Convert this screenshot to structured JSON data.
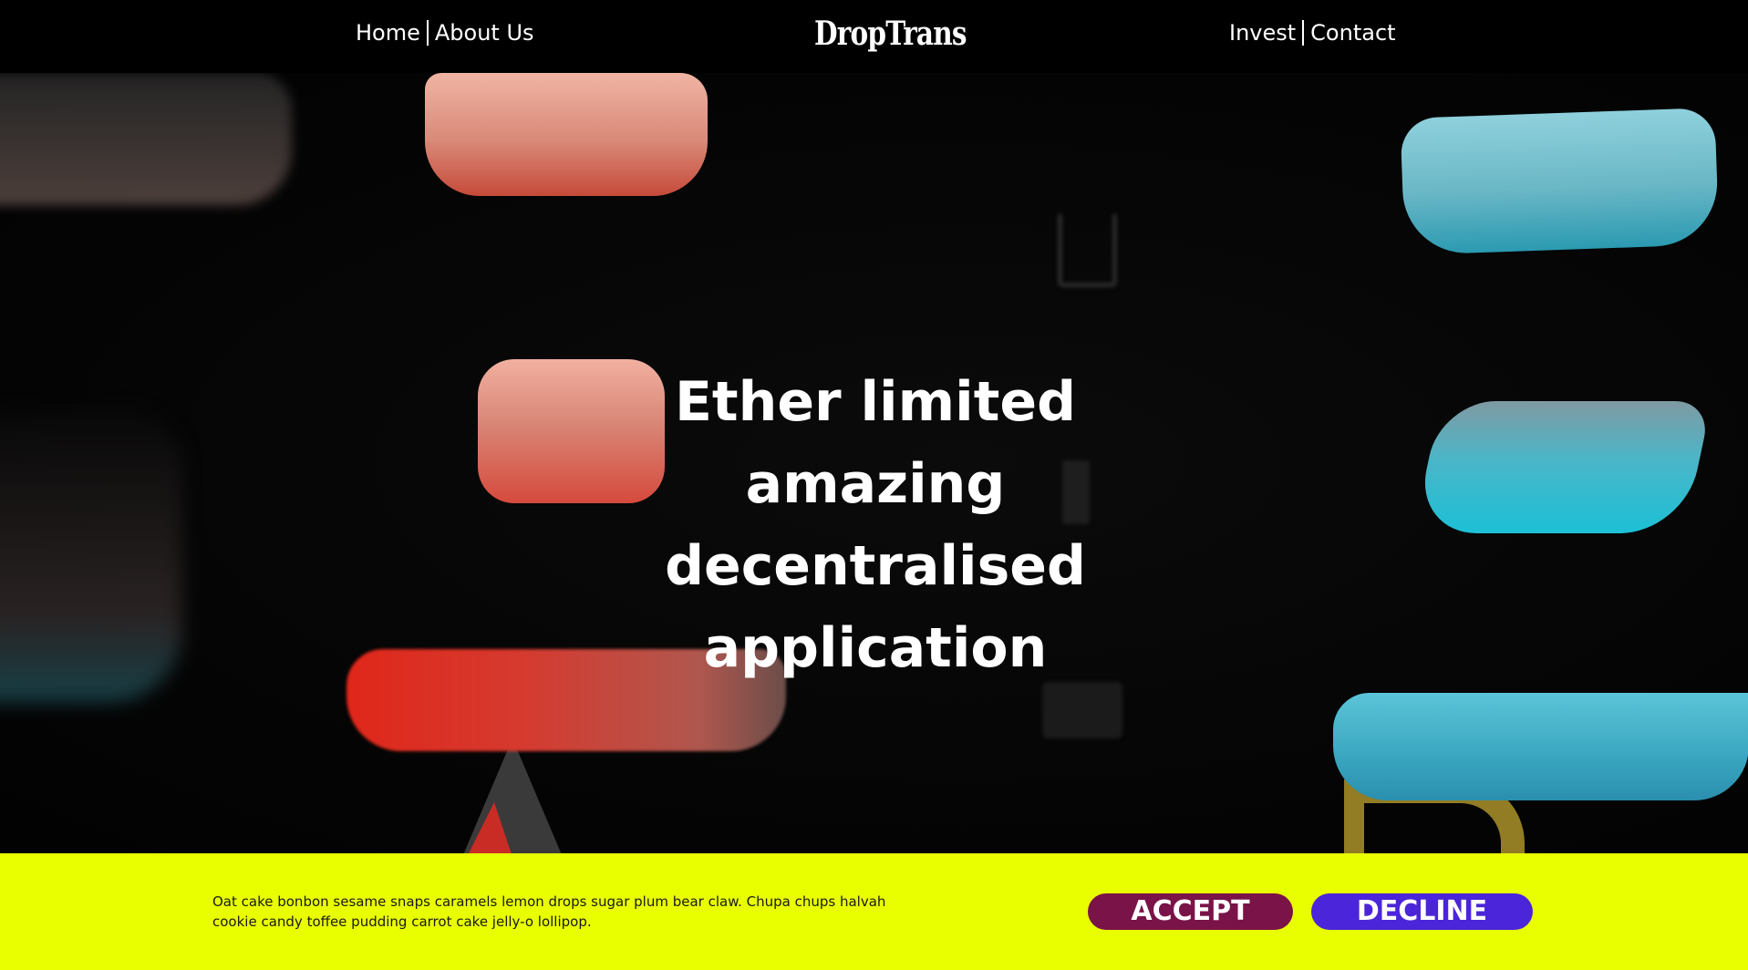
{
  "header": {
    "nav_left": [
      {
        "label": "Home"
      },
      {
        "label": "About Us"
      }
    ],
    "logo": "DropTrans",
    "nav_right": [
      {
        "label": "Invest"
      },
      {
        "label": "Contact"
      }
    ]
  },
  "hero": {
    "headline_lines": [
      "Ether limited",
      "amazing",
      "decentralised",
      "application"
    ]
  },
  "cookie_banner": {
    "text": "Oat cake bonbon sesame snaps caramels lemon drops sugar plum bear claw. Chupa chups halvah cookie candy toffee pudding carrot cake jelly-o lollipop.",
    "accept_label": "ACCEPT",
    "decline_label": "DECLINE",
    "background_color": "#e9ff00",
    "accept_color": "#7a1347",
    "decline_color": "#4b25d9"
  }
}
